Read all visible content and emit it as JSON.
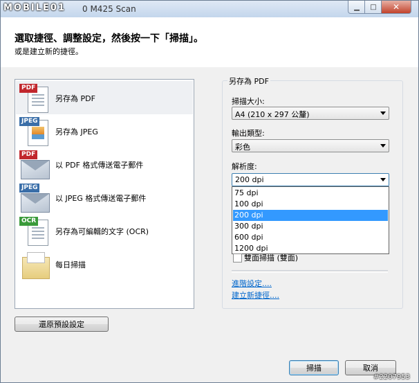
{
  "window": {
    "logo": "MOBILE01",
    "title": "0 M425 Scan",
    "min_glyph": "▁",
    "max_glyph": "□",
    "close_glyph": "✕"
  },
  "header": {
    "heading": "選取捷徑、調整設定，然後按一下「掃描」。",
    "subheading": "或是建立新的捷徑。"
  },
  "shortcuts": [
    {
      "label": "另存為 PDF",
      "icon": "pdf-document-icon",
      "tag": "PDF",
      "selected": true
    },
    {
      "label": "另存為 JPEG",
      "icon": "jpeg-document-icon",
      "tag": "JPEG",
      "selected": false
    },
    {
      "label": "以 PDF 格式傳送電子郵件",
      "icon": "pdf-email-icon",
      "tag": "PDF",
      "selected": false
    },
    {
      "label": "以 JPEG 格式傳送電子郵件",
      "icon": "jpeg-email-icon",
      "tag": "JPEG",
      "selected": false
    },
    {
      "label": "另存為可編輯的文字 (OCR)",
      "icon": "ocr-document-icon",
      "tag": "OCR",
      "selected": false
    },
    {
      "label": "每日掃描",
      "icon": "folder-icon",
      "tag": "",
      "selected": false
    }
  ],
  "settings": {
    "group_title": "另存為 PDF",
    "scan_size_label": "掃描大小:",
    "scan_size_value": "A4 (210 x 297 公釐)",
    "output_type_label": "輸出類型:",
    "output_type_value": "彩色",
    "resolution_label": "解析度:",
    "resolution_value": "200 dpi",
    "resolution_options": [
      "75 dpi",
      "100 dpi",
      "200 dpi",
      "300 dpi",
      "600 dpi",
      "1200 dpi"
    ],
    "resolution_selected_index": 2,
    "duplex_label": "雙面掃描 (雙面)",
    "duplex_checked": false,
    "advanced_link": "進階設定....",
    "new_shortcut_link": "建立新捷徑...."
  },
  "buttons": {
    "restore_defaults": "還原預設設定",
    "scan": "掃描",
    "cancel": "取消"
  },
  "watermark": "#2207953",
  "colors": {
    "selection": "#3399ff",
    "link": "#0066cc",
    "pdf_tag": "#c1272d",
    "jpeg_tag": "#3a6ea8",
    "ocr_tag": "#3a9a3a"
  }
}
